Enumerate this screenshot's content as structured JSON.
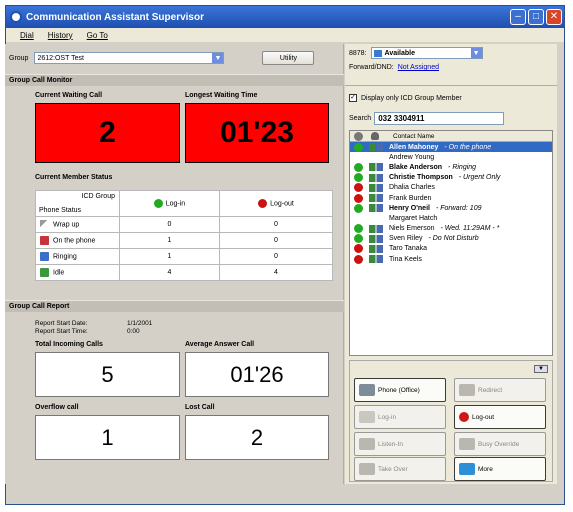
{
  "window": {
    "title": "Communication Assistant Supervisor"
  },
  "menu": {
    "dial": "Dial",
    "history": "History",
    "goto": "Go To"
  },
  "group": {
    "label": "Group",
    "selected": "2612:OST Test",
    "utility_button": "Utility"
  },
  "monitor": {
    "header": "Group Call Monitor",
    "current_waiting_label": "Current Waiting Call",
    "current_waiting_value": "2",
    "longest_waiting_label": "Longest Waiting Time",
    "longest_waiting_value": "01'23"
  },
  "member_status": {
    "header": "Current Member Status",
    "corner_top": "ICD Group",
    "corner_bottom": "Phone Status",
    "login_header": "Log-in",
    "logout_header": "Log-out",
    "rows": [
      {
        "label": "Wrap up",
        "login": "0",
        "logout": "0"
      },
      {
        "label": "On the phone",
        "login": "1",
        "logout": "0"
      },
      {
        "label": "Ringing",
        "login": "1",
        "logout": "0"
      },
      {
        "label": "Idle",
        "login": "4",
        "logout": "4"
      }
    ]
  },
  "report": {
    "header": "Group Call Report",
    "start_date_label": "Report Start Date:",
    "start_date_value": "1/1/2001",
    "start_time_label": "Report Start Time:",
    "start_time_value": "0:00",
    "total_incoming_label": "Total Incoming Calls",
    "total_incoming_value": "5",
    "avg_answer_label": "Average Answer Call",
    "avg_answer_value": "01'26",
    "overflow_label": "Overflow call",
    "overflow_value": "1",
    "lost_label": "Lost Call",
    "lost_value": "2"
  },
  "presence": {
    "extension": "8878:",
    "status": "Available",
    "forward_label": "Forward/DND:",
    "forward_value": "Not Assigned"
  },
  "filter": {
    "checkbox_label": "Display only ICD Group Member",
    "checked": true
  },
  "search": {
    "label": "Search",
    "value": "032 3304911"
  },
  "contacts": {
    "header": "Contact Name",
    "items": [
      {
        "name": "Allen Mahoney",
        "status": "- On the phone",
        "dot": "green",
        "bold": true,
        "selected": true,
        "phone": true
      },
      {
        "name": "Andrew Young",
        "status": "",
        "dot": "none",
        "bold": false,
        "selected": false,
        "phone": false
      },
      {
        "name": "Blake Anderson",
        "status": "- Ringing",
        "dot": "green",
        "bold": true,
        "selected": false,
        "phone": true
      },
      {
        "name": "Christie Thompson",
        "status": "- Urgent Only",
        "dot": "green",
        "bold": true,
        "selected": false,
        "phone": true
      },
      {
        "name": "Dhalia Charles",
        "status": "",
        "dot": "red",
        "bold": false,
        "selected": false,
        "phone": true
      },
      {
        "name": "Frank Burden",
        "status": "",
        "dot": "red",
        "bold": false,
        "selected": false,
        "phone": true
      },
      {
        "name": "Henry O'neil",
        "status": "- Forward: 109",
        "dot": "green",
        "bold": true,
        "selected": false,
        "phone": true
      },
      {
        "name": "Margaret Hatch",
        "status": "",
        "dot": "none",
        "bold": false,
        "selected": false,
        "phone": false
      },
      {
        "name": "Niels Emerson",
        "status": "- Wed. 11:29AM - *",
        "dot": "green",
        "bold": false,
        "selected": false,
        "phone": true
      },
      {
        "name": "Sven Riley",
        "status": "- Do Not Disturb",
        "dot": "green",
        "bold": false,
        "selected": false,
        "phone": true
      },
      {
        "name": "Taro Tanaka",
        "status": "",
        "dot": "red",
        "bold": false,
        "selected": false,
        "phone": true
      },
      {
        "name": "Tina Keels",
        "status": "",
        "dot": "red",
        "bold": false,
        "selected": false,
        "phone": true
      }
    ]
  },
  "actions": {
    "phone_office": "Phone (Office)",
    "redirect": "Redirect",
    "login": "Log-in",
    "logout": "Log-out",
    "listen_in": "Listen-In",
    "busy_override": "Busy Override",
    "take_over": "Take Over",
    "more": "More"
  },
  "colors": {
    "title_bar": "#1f4fb0",
    "alert_red": "#ff0000",
    "selected_row": "#316ac5"
  }
}
